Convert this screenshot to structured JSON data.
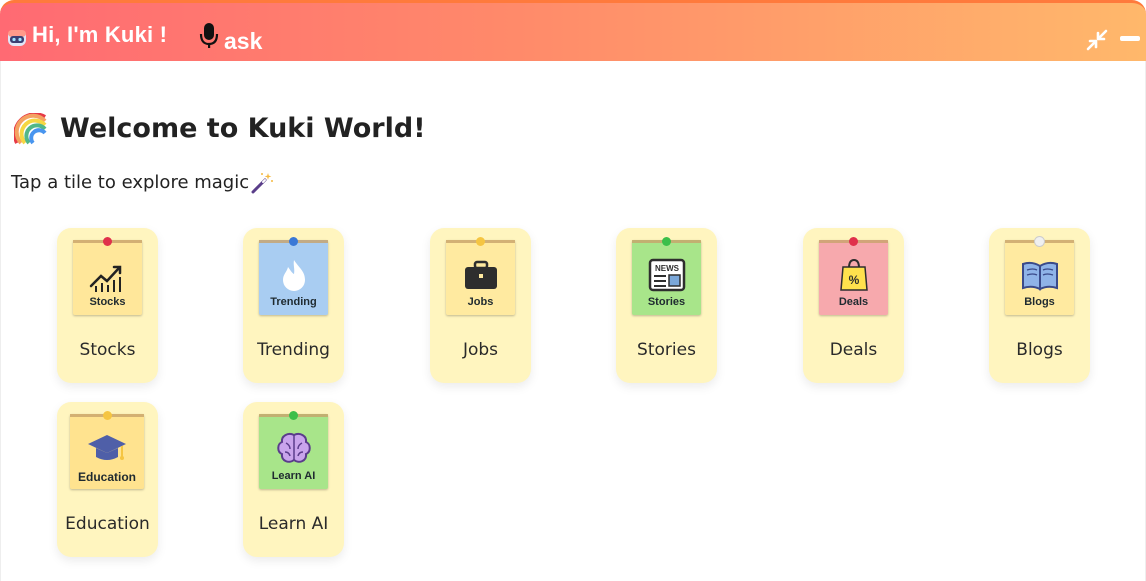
{
  "header": {
    "greeting": "Hi, I'm Kuki !",
    "ask_label": "ask",
    "icons": [
      "robot-avatar-icon",
      "microphone-icon",
      "collapse-arrows-icon",
      "minimize-icon"
    ]
  },
  "main": {
    "welcome_title": "Welcome to Kuki World!",
    "subtitle": "Tap a tile to explore magic",
    "title_icon": "rainbow-icon",
    "subtitle_icon": "magic-wand-icon"
  },
  "tiles": [
    {
      "label": "Stocks",
      "note_text": "Stocks",
      "icon": "chart-up-icon",
      "note_color": "#ffe79a",
      "pin_color": "#e0314b"
    },
    {
      "label": "Trending",
      "note_text": "Trending",
      "icon": "flame-icon",
      "note_color": "#a9cdf2",
      "pin_color": "#3a78d6"
    },
    {
      "label": "Jobs",
      "note_text": "Jobs",
      "icon": "briefcase-icon",
      "note_color": "#ffeaa0",
      "pin_color": "#f5c542"
    },
    {
      "label": "Stories",
      "note_text": "Stories",
      "icon": "newspaper-icon",
      "note_color": "#a8e58a",
      "pin_color": "#3bbf4a"
    },
    {
      "label": "Deals",
      "note_text": "Deals",
      "icon": "shopping-bag-icon",
      "note_color": "#f7a9ad",
      "pin_color": "#e0314b"
    },
    {
      "label": "Blogs",
      "note_text": "Blogs",
      "icon": "open-book-icon",
      "note_color": "#ffeaa0",
      "pin_color": "#f0f0f0"
    },
    {
      "label": "Education",
      "note_text": "Education",
      "icon": "graduation-cap-icon",
      "note_color": "#ffe38f",
      "pin_color": "#f5c542"
    },
    {
      "label": "Learn AI",
      "note_text": "Learn AI",
      "icon": "brain-icon",
      "note_color": "#a8e58a",
      "pin_color": "#3bbf4a"
    }
  ],
  "colors": {
    "header_gradient_start": "#ff6a73",
    "header_gradient_end": "#ffb86b",
    "tile_background": "#fff5bf"
  }
}
